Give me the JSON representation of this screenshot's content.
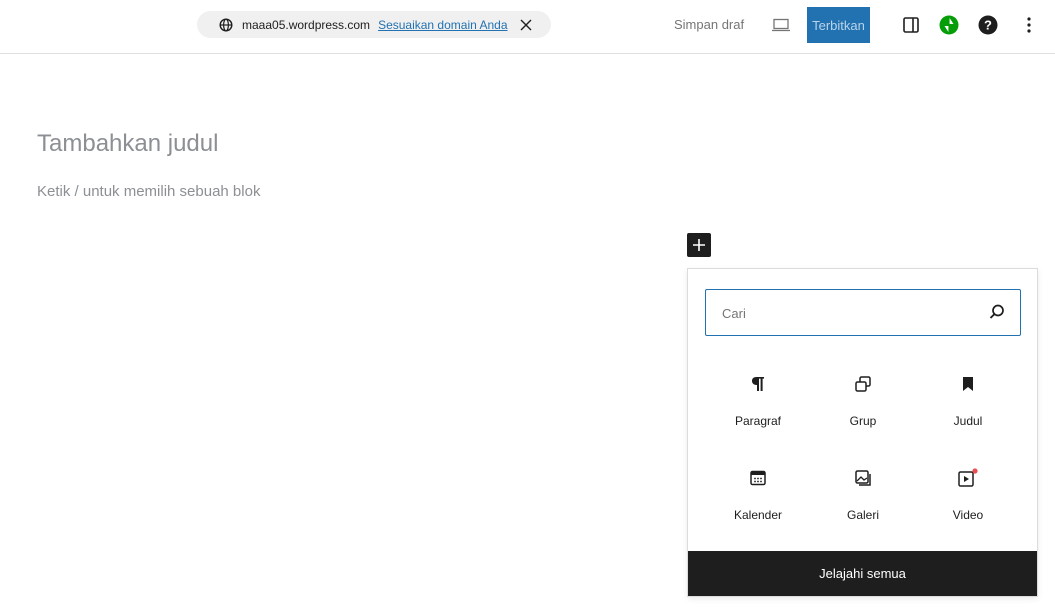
{
  "topbar": {
    "site_url": "maaa05.wordpress.com",
    "customize_domain_link": "Sesuaikan domain Anda",
    "save_draft": "Simpan draf",
    "publish": "Terbitkan",
    "icons": {
      "globe": "globe-icon",
      "close": "close-icon",
      "preview": "desktop-preview-icon",
      "settings": "sidebar-toggle-icon",
      "jetpack": "jetpack-icon",
      "help": "help-icon",
      "more": "more-vertical-icon"
    }
  },
  "editor": {
    "title_placeholder": "Tambahkan judul",
    "block_placeholder": "Ketik / untuk memilih sebuah blok"
  },
  "inserter": {
    "search_placeholder": "Cari",
    "blocks": [
      {
        "label": "Paragraf",
        "icon": "paragraph-icon"
      },
      {
        "label": "Grup",
        "icon": "group-icon"
      },
      {
        "label": "Judul",
        "icon": "bookmark-icon"
      },
      {
        "label": "Kalender",
        "icon": "calendar-icon"
      },
      {
        "label": "Galeri",
        "icon": "gallery-icon"
      },
      {
        "label": "Video",
        "icon": "video-icon"
      }
    ],
    "browse_all": "Jelajahi semua"
  },
  "colors": {
    "accent": "#2271b1",
    "jetpack": "#069e08",
    "dark": "#1e1e1e",
    "new_badge": "#e65054"
  }
}
